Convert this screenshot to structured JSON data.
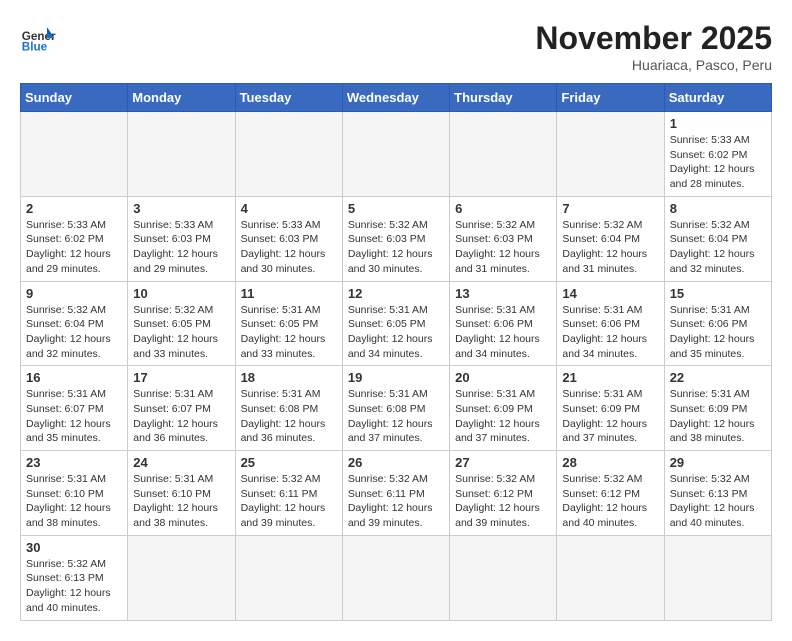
{
  "header": {
    "logo_general": "General",
    "logo_blue": "Blue",
    "month_title": "November 2025",
    "subtitle": "Huariaca, Pasco, Peru"
  },
  "weekdays": [
    "Sunday",
    "Monday",
    "Tuesday",
    "Wednesday",
    "Thursday",
    "Friday",
    "Saturday"
  ],
  "weeks": [
    [
      {
        "day": "",
        "info": "",
        "empty": true
      },
      {
        "day": "",
        "info": "",
        "empty": true
      },
      {
        "day": "",
        "info": "",
        "empty": true
      },
      {
        "day": "",
        "info": "",
        "empty": true
      },
      {
        "day": "",
        "info": "",
        "empty": true
      },
      {
        "day": "",
        "info": "",
        "empty": true
      },
      {
        "day": "1",
        "info": "Sunrise: 5:33 AM\nSunset: 6:02 PM\nDaylight: 12 hours and 28 minutes."
      }
    ],
    [
      {
        "day": "2",
        "info": "Sunrise: 5:33 AM\nSunset: 6:02 PM\nDaylight: 12 hours and 29 minutes."
      },
      {
        "day": "3",
        "info": "Sunrise: 5:33 AM\nSunset: 6:03 PM\nDaylight: 12 hours and 29 minutes."
      },
      {
        "day": "4",
        "info": "Sunrise: 5:33 AM\nSunset: 6:03 PM\nDaylight: 12 hours and 30 minutes."
      },
      {
        "day": "5",
        "info": "Sunrise: 5:32 AM\nSunset: 6:03 PM\nDaylight: 12 hours and 30 minutes."
      },
      {
        "day": "6",
        "info": "Sunrise: 5:32 AM\nSunset: 6:03 PM\nDaylight: 12 hours and 31 minutes."
      },
      {
        "day": "7",
        "info": "Sunrise: 5:32 AM\nSunset: 6:04 PM\nDaylight: 12 hours and 31 minutes."
      },
      {
        "day": "8",
        "info": "Sunrise: 5:32 AM\nSunset: 6:04 PM\nDaylight: 12 hours and 32 minutes."
      }
    ],
    [
      {
        "day": "9",
        "info": "Sunrise: 5:32 AM\nSunset: 6:04 PM\nDaylight: 12 hours and 32 minutes."
      },
      {
        "day": "10",
        "info": "Sunrise: 5:32 AM\nSunset: 6:05 PM\nDaylight: 12 hours and 33 minutes."
      },
      {
        "day": "11",
        "info": "Sunrise: 5:31 AM\nSunset: 6:05 PM\nDaylight: 12 hours and 33 minutes."
      },
      {
        "day": "12",
        "info": "Sunrise: 5:31 AM\nSunset: 6:05 PM\nDaylight: 12 hours and 34 minutes."
      },
      {
        "day": "13",
        "info": "Sunrise: 5:31 AM\nSunset: 6:06 PM\nDaylight: 12 hours and 34 minutes."
      },
      {
        "day": "14",
        "info": "Sunrise: 5:31 AM\nSunset: 6:06 PM\nDaylight: 12 hours and 34 minutes."
      },
      {
        "day": "15",
        "info": "Sunrise: 5:31 AM\nSunset: 6:06 PM\nDaylight: 12 hours and 35 minutes."
      }
    ],
    [
      {
        "day": "16",
        "info": "Sunrise: 5:31 AM\nSunset: 6:07 PM\nDaylight: 12 hours and 35 minutes."
      },
      {
        "day": "17",
        "info": "Sunrise: 5:31 AM\nSunset: 6:07 PM\nDaylight: 12 hours and 36 minutes."
      },
      {
        "day": "18",
        "info": "Sunrise: 5:31 AM\nSunset: 6:08 PM\nDaylight: 12 hours and 36 minutes."
      },
      {
        "day": "19",
        "info": "Sunrise: 5:31 AM\nSunset: 6:08 PM\nDaylight: 12 hours and 37 minutes."
      },
      {
        "day": "20",
        "info": "Sunrise: 5:31 AM\nSunset: 6:09 PM\nDaylight: 12 hours and 37 minutes."
      },
      {
        "day": "21",
        "info": "Sunrise: 5:31 AM\nSunset: 6:09 PM\nDaylight: 12 hours and 37 minutes."
      },
      {
        "day": "22",
        "info": "Sunrise: 5:31 AM\nSunset: 6:09 PM\nDaylight: 12 hours and 38 minutes."
      }
    ],
    [
      {
        "day": "23",
        "info": "Sunrise: 5:31 AM\nSunset: 6:10 PM\nDaylight: 12 hours and 38 minutes."
      },
      {
        "day": "24",
        "info": "Sunrise: 5:31 AM\nSunset: 6:10 PM\nDaylight: 12 hours and 38 minutes."
      },
      {
        "day": "25",
        "info": "Sunrise: 5:32 AM\nSunset: 6:11 PM\nDaylight: 12 hours and 39 minutes."
      },
      {
        "day": "26",
        "info": "Sunrise: 5:32 AM\nSunset: 6:11 PM\nDaylight: 12 hours and 39 minutes."
      },
      {
        "day": "27",
        "info": "Sunrise: 5:32 AM\nSunset: 6:12 PM\nDaylight: 12 hours and 39 minutes."
      },
      {
        "day": "28",
        "info": "Sunrise: 5:32 AM\nSunset: 6:12 PM\nDaylight: 12 hours and 40 minutes."
      },
      {
        "day": "29",
        "info": "Sunrise: 5:32 AM\nSunset: 6:13 PM\nDaylight: 12 hours and 40 minutes."
      }
    ],
    [
      {
        "day": "30",
        "info": "Sunrise: 5:32 AM\nSunset: 6:13 PM\nDaylight: 12 hours and 40 minutes."
      },
      {
        "day": "",
        "info": "",
        "empty": true
      },
      {
        "day": "",
        "info": "",
        "empty": true
      },
      {
        "day": "",
        "info": "",
        "empty": true
      },
      {
        "day": "",
        "info": "",
        "empty": true
      },
      {
        "day": "",
        "info": "",
        "empty": true
      },
      {
        "day": "",
        "info": "",
        "empty": true
      }
    ]
  ]
}
